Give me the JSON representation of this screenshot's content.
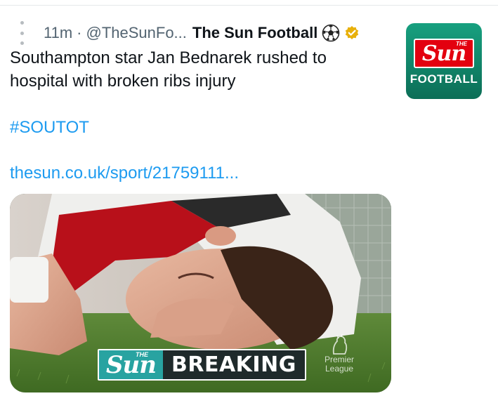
{
  "tweet": {
    "time": "11m",
    "separator": "·",
    "handle": "@TheSunFo...",
    "display_name": "The Sun Football",
    "text": "Southampton star Jan Bednarek rushed to hospital with broken ribs injury",
    "hashtag": "#SOUTOT",
    "link": "thesun.co.uk/sport/21759111...",
    "icons": {
      "more": "more-vertical-icon",
      "ball": "soccer-ball-icon",
      "verified": "verified-badge-icon"
    }
  },
  "avatar": {
    "logo_small": "THE",
    "logo": "Sun",
    "label": "FOOTBALL"
  },
  "media": {
    "banner_small": "THE",
    "banner_logo": "Sun",
    "banner_text": "BREAKING",
    "league_line1": "Premier",
    "league_line2": "League"
  },
  "colors": {
    "link": "#1d9bf0",
    "text": "#0f1419",
    "meta": "#536471",
    "verified": "#e8b00a",
    "sun_red": "#e3000f",
    "avatar_green": "#138b6e",
    "banner_teal": "#28a3a1"
  }
}
